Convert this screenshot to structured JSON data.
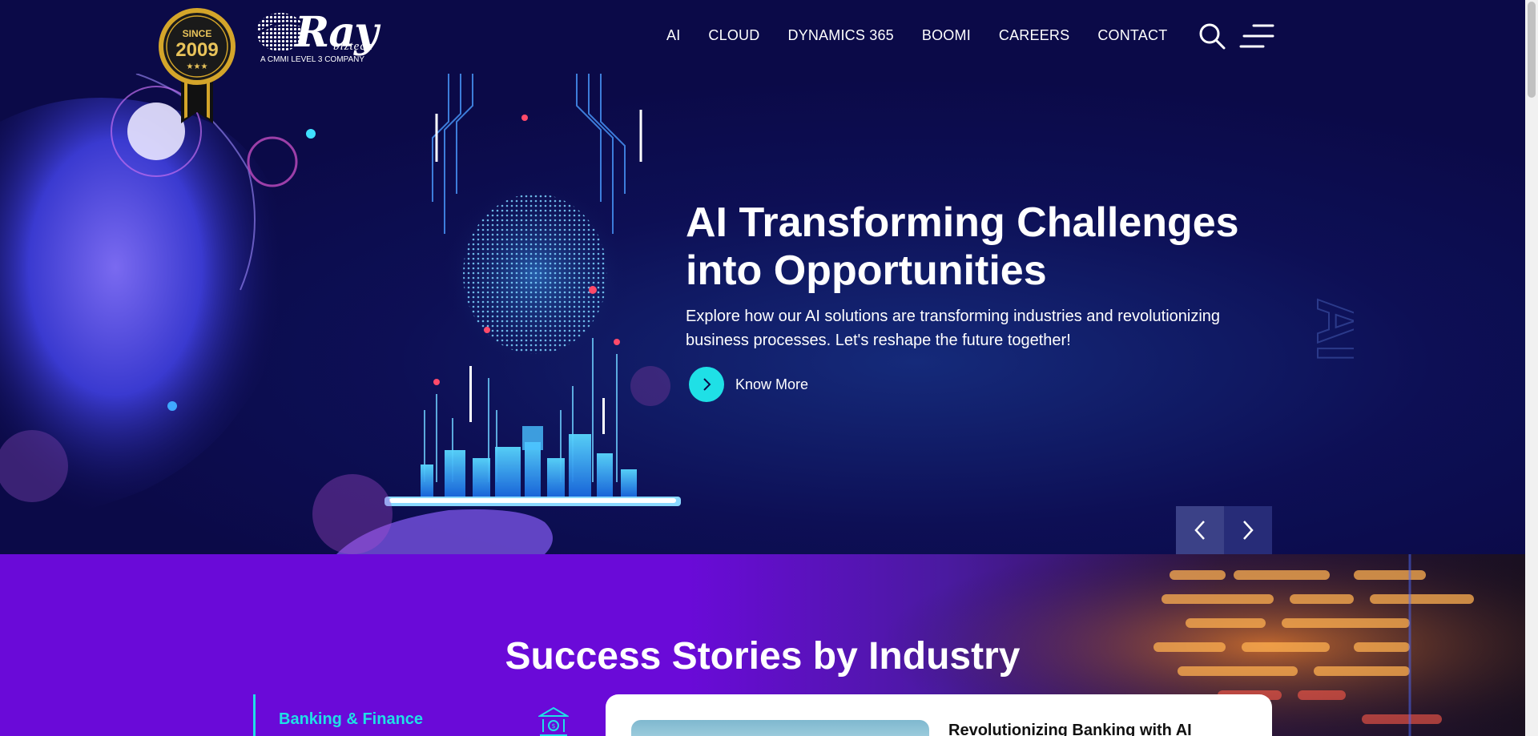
{
  "header": {
    "badge": {
      "top_text": "SINCE",
      "year": "2009",
      "stars": "★★★"
    },
    "logo": {
      "name": "Ray",
      "sub": "biztech",
      "tagline": "A CMMI LEVEL 3 COMPANY"
    },
    "nav": [
      {
        "label": "AI"
      },
      {
        "label": "CLOUD"
      },
      {
        "label": "DYNAMICS 365"
      },
      {
        "label": "BOOMI"
      },
      {
        "label": "CAREERS"
      },
      {
        "label": "CONTACT"
      }
    ],
    "icons": {
      "search": "search-icon",
      "menu": "menu-icon"
    }
  },
  "hero": {
    "title": "AI Transforming Challenges into Opportunities",
    "description": "Explore how our AI solutions are transforming industries and revolutionizing business processes. Let's reshape the future together!",
    "cta_label": "Know More",
    "watermark": "AI"
  },
  "success": {
    "title": "Success Stories by Industry",
    "active_industry": "Banking & Finance",
    "story_title": "Revolutionizing Banking with AI"
  },
  "colors": {
    "navy": "#0b0a48",
    "accent": "#1fe0e6",
    "purple": "#6a0ad8",
    "gold": "#d4a52a"
  }
}
